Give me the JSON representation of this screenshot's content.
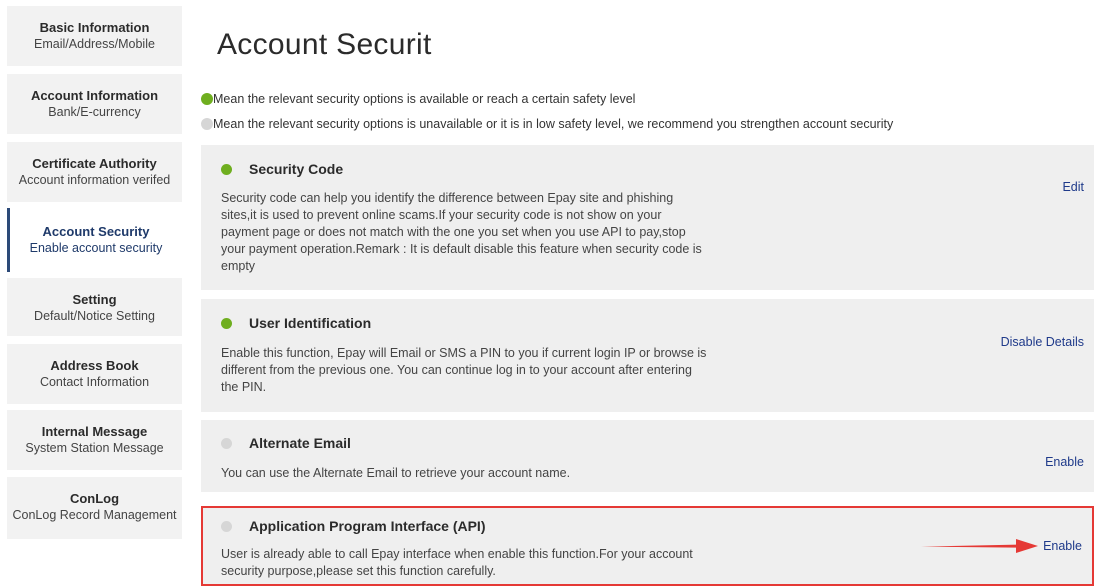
{
  "sidebar": {
    "items": [
      {
        "title": "Basic Information",
        "subtitle": "Email/Address/Mobile"
      },
      {
        "title": "Account Information",
        "subtitle": "Bank/E-currency"
      },
      {
        "title": "Certificate Authority",
        "subtitle": "Account information verifed"
      },
      {
        "title": "Account Security",
        "subtitle": "Enable account security"
      },
      {
        "title": "Setting",
        "subtitle": "Default/Notice Setting"
      },
      {
        "title": "Address Book",
        "subtitle": "Contact Information"
      },
      {
        "title": "Internal Message",
        "subtitle": "System Station Message"
      },
      {
        "title": "ConLog",
        "subtitle": "ConLog Record Management"
      }
    ]
  },
  "main": {
    "title": "Account Securit",
    "legend": {
      "on": "Mean the relevant security options is available or reach a certain safety level",
      "off": "Mean the relevant security options is unavailable or it is in low safety level, we recommend you strengthen account security"
    },
    "options": [
      {
        "name": "Security Code",
        "status": "on",
        "description": "Security code can help you identify the difference between Epay site and phishing sites,it is used to prevent online scams.If your security code is not show on your payment page or does not match with the one you set when you use API to pay,stop your payment operation.Remark : It is default disable this feature when security code is empty",
        "action": "Edit"
      },
      {
        "name": "User Identification",
        "status": "on",
        "description": "Enable this function, Epay will Email or SMS a PIN to you if current login IP or browse is different from the previous one. You can continue log in to your account after entering the PIN.",
        "action": "Disable Details"
      },
      {
        "name": "Alternate Email",
        "status": "off",
        "description": "You can use the Alternate Email to retrieve your account name.",
        "action": "Enable"
      },
      {
        "name": "Application Program Interface (API)",
        "status": "off",
        "description": "User is already able to call Epay interface when enable this function.For your account security purpose,please set this function carefully.",
        "action": "Enable"
      }
    ]
  },
  "colors": {
    "accent": "#2c4a78",
    "status_on": "#6fae1f",
    "status_off": "#d6d6d6",
    "highlight": "#e53935",
    "link": "#1f3a8a"
  }
}
